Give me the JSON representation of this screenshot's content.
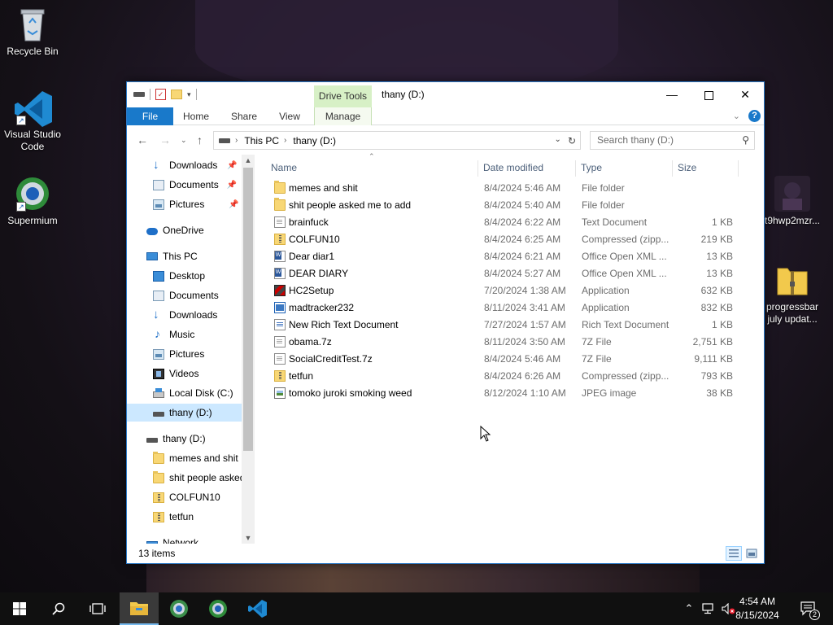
{
  "desktop": {
    "icons": [
      {
        "label": "Recycle Bin"
      },
      {
        "label": "Visual Studio Code"
      },
      {
        "label": "Supermium"
      },
      {
        "label": "t9hwp2mzr..."
      },
      {
        "label": "progressbar july updat..."
      }
    ]
  },
  "window": {
    "title": "thany (D:)",
    "drive_tools_label": "Drive Tools",
    "tabs": {
      "file": "File",
      "home": "Home",
      "share": "Share",
      "view": "View",
      "manage": "Manage"
    },
    "address": {
      "crumbs": [
        "This PC",
        "thany (D:)"
      ]
    },
    "search_placeholder": "Search thany (D:)",
    "columns": {
      "name": "Name",
      "date": "Date modified",
      "type": "Type",
      "size": "Size"
    },
    "nav": {
      "quick_access": [
        {
          "label": "Downloads"
        },
        {
          "label": "Documents"
        },
        {
          "label": "Pictures"
        }
      ],
      "onedrive": "OneDrive",
      "this_pc": "This PC",
      "this_pc_items": [
        {
          "label": "Desktop"
        },
        {
          "label": "Documents"
        },
        {
          "label": "Downloads"
        },
        {
          "label": "Music"
        },
        {
          "label": "Pictures"
        },
        {
          "label": "Videos"
        },
        {
          "label": "Local Disk (C:)"
        },
        {
          "label": "thany (D:)"
        }
      ],
      "drive": "thany (D:)",
      "drive_items": [
        {
          "label": "memes and shit"
        },
        {
          "label": "shit people asked me to add"
        },
        {
          "label": "COLFUN10"
        },
        {
          "label": "tetfun"
        }
      ],
      "network": "Network"
    },
    "files": [
      {
        "name": "memes and shit",
        "date": "8/4/2024 5:46 AM",
        "type": "File folder",
        "size": "",
        "icon": "folder-icon"
      },
      {
        "name": "shit people asked me to add",
        "date": "8/4/2024 5:40 AM",
        "type": "File folder",
        "size": "",
        "icon": "folder-icon"
      },
      {
        "name": "brainfuck",
        "date": "8/4/2024 6:22 AM",
        "type": "Text Document",
        "size": "1 KB",
        "icon": "text-file-icon"
      },
      {
        "name": "COLFUN10",
        "date": "8/4/2024 6:25 AM",
        "type": "Compressed (zipp...",
        "size": "219 KB",
        "icon": "zip-folder-icon"
      },
      {
        "name": "Dear diar1",
        "date": "8/4/2024 6:21 AM",
        "type": "Office Open XML ...",
        "size": "13 KB",
        "icon": "word-document-icon"
      },
      {
        "name": "DEAR DIARY",
        "date": "8/4/2024 5:27 AM",
        "type": "Office Open XML ...",
        "size": "13 KB",
        "icon": "word-document-icon"
      },
      {
        "name": "HC2Setup",
        "date": "7/20/2024 1:38 AM",
        "type": "Application",
        "size": "632 KB",
        "icon": "installer-icon"
      },
      {
        "name": "madtracker232",
        "date": "8/11/2024 3:41 AM",
        "type": "Application",
        "size": "832 KB",
        "icon": "application-icon"
      },
      {
        "name": "New Rich Text Document",
        "date": "7/27/2024 1:57 AM",
        "type": "Rich Text Document",
        "size": "1 KB",
        "icon": "rtf-file-icon"
      },
      {
        "name": "obama.7z",
        "date": "8/11/2024 3:50 AM",
        "type": "7Z File",
        "size": "2,751 KB",
        "icon": "blank-file-icon"
      },
      {
        "name": "SocialCreditTest.7z",
        "date": "8/4/2024 5:46 AM",
        "type": "7Z File",
        "size": "9,111 KB",
        "icon": "blank-file-icon"
      },
      {
        "name": "tetfun",
        "date": "8/4/2024 6:26 AM",
        "type": "Compressed (zipp...",
        "size": "793 KB",
        "icon": "zip-folder-icon"
      },
      {
        "name": "tomoko juroki smoking weed",
        "date": "8/12/2024 1:10 AM",
        "type": "JPEG image",
        "size": "38 KB",
        "icon": "image-file-icon"
      }
    ],
    "status": {
      "item_count": "13 items"
    }
  },
  "taskbar": {
    "clock_time": "4:54 AM",
    "clock_date": "8/15/2024",
    "notification_count": "2"
  },
  "colors": {
    "accent": "#1979ca",
    "selection": "#cce8ff",
    "drive_tools": "#d7f0c6"
  }
}
